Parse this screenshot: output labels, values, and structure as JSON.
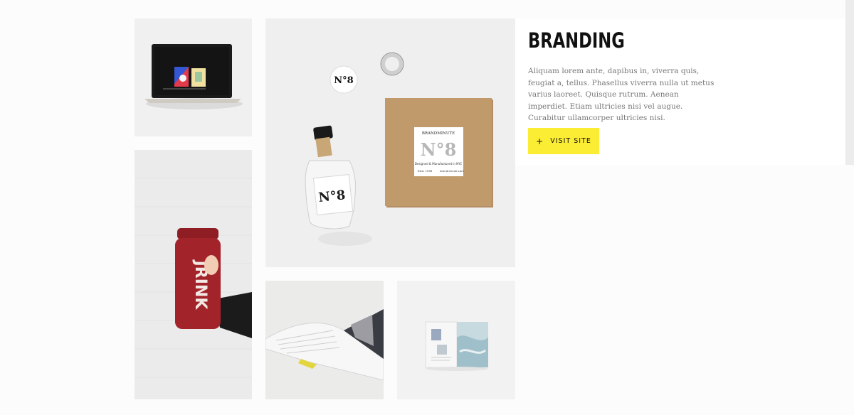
{
  "project": {
    "title": "BRANDING",
    "description": "Aliquam lorem ante, dapibus in, viverra quis, feugiat a, tellus. Phasellus viverra nulla ut metus varius laoreet. Quisque rutrum. Aenean imperdiet. Etiam ultricies nisi vel augue. Curabitur ullamcorper ultricies nisi.",
    "button": {
      "icon": "+",
      "icon_name": "plus-icon",
      "label": "VISIT SITE"
    }
  },
  "colors": {
    "accent": "#fbec34",
    "title": "#111111",
    "body_text": "#777777",
    "background": "#fcfcfc"
  },
  "gallery": {
    "images": [
      {
        "name": "laptop-mockup-image"
      },
      {
        "name": "juice-bottle-image",
        "label": "JRINK"
      },
      {
        "name": "branded-package-image",
        "brand": "BRANDMINUTE",
        "number": "N°8",
        "box_tagline": "Designed & Manufactured in NYC",
        "est": "Estd. 1996",
        "site": "brandminute.com"
      },
      {
        "name": "open-book-image"
      },
      {
        "name": "magazine-spread-image"
      }
    ]
  }
}
